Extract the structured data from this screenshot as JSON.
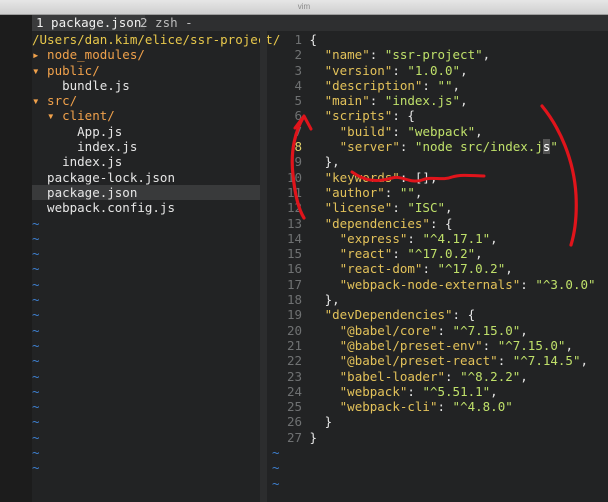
{
  "window": {
    "title": "vim"
  },
  "tabs": [
    {
      "label": "1 package.json"
    },
    {
      "label": "2 zsh -"
    }
  ],
  "file_tree": {
    "root": "/Users/dan.kim/elice/ssr-project/",
    "items": [
      {
        "text": "▸ node_modules/",
        "kind": "dir"
      },
      {
        "text": "▾ public/",
        "kind": "dir"
      },
      {
        "text": "    bundle.js",
        "kind": "file"
      },
      {
        "text": "▾ src/",
        "kind": "dir"
      },
      {
        "text": "  ▾ client/",
        "kind": "dir"
      },
      {
        "text": "      App.js",
        "kind": "file"
      },
      {
        "text": "      index.js",
        "kind": "file"
      },
      {
        "text": "    index.js",
        "kind": "file"
      },
      {
        "text": "  package-lock.json",
        "kind": "file"
      },
      {
        "text": "  package.json",
        "kind": "file",
        "current": true
      },
      {
        "text": "  webpack.config.js",
        "kind": "file"
      }
    ],
    "tilde_rows": 17
  },
  "editor": {
    "current_line": 8,
    "lines": [
      {
        "n": "1",
        "indent": "",
        "parts": [
          {
            "t": "{",
            "c": "p"
          }
        ]
      },
      {
        "n": "2",
        "indent": "  ",
        "parts": [
          {
            "t": "\"name\"",
            "c": "k"
          },
          {
            "t": ": ",
            "c": "p"
          },
          {
            "t": "\"ssr-project\"",
            "c": "s"
          },
          {
            "t": ",",
            "c": "p"
          }
        ]
      },
      {
        "n": "3",
        "indent": "  ",
        "parts": [
          {
            "t": "\"version\"",
            "c": "k"
          },
          {
            "t": ": ",
            "c": "p"
          },
          {
            "t": "\"1.0.0\"",
            "c": "s"
          },
          {
            "t": ",",
            "c": "p"
          }
        ]
      },
      {
        "n": "4",
        "indent": "  ",
        "parts": [
          {
            "t": "\"description\"",
            "c": "k"
          },
          {
            "t": ": ",
            "c": "p"
          },
          {
            "t": "\"\"",
            "c": "s"
          },
          {
            "t": ",",
            "c": "p"
          }
        ]
      },
      {
        "n": "5",
        "indent": "  ",
        "parts": [
          {
            "t": "\"main\"",
            "c": "k"
          },
          {
            "t": ": ",
            "c": "p"
          },
          {
            "t": "\"index.js\"",
            "c": "s"
          },
          {
            "t": ",",
            "c": "p"
          }
        ]
      },
      {
        "n": "6",
        "indent": "  ",
        "parts": [
          {
            "t": "\"scripts\"",
            "c": "k"
          },
          {
            "t": ": {",
            "c": "p"
          }
        ]
      },
      {
        "n": "7",
        "indent": "    ",
        "parts": [
          {
            "t": "\"build\"",
            "c": "k"
          },
          {
            "t": ": ",
            "c": "p"
          },
          {
            "t": "\"webpack\"",
            "c": "s"
          },
          {
            "t": ",",
            "c": "p"
          }
        ]
      },
      {
        "n": "8",
        "indent": "    ",
        "parts": [
          {
            "t": "\"server\"",
            "c": "k"
          },
          {
            "t": ": ",
            "c": "p"
          },
          {
            "t": "\"node src/index.j",
            "c": "s"
          },
          {
            "t": "s",
            "c": "cursor"
          },
          {
            "t": "\"",
            "c": "s"
          }
        ]
      },
      {
        "n": "9",
        "indent": "  ",
        "parts": [
          {
            "t": "},",
            "c": "p"
          }
        ]
      },
      {
        "n": "10",
        "indent": "  ",
        "parts": [
          {
            "t": "\"keywords\"",
            "c": "k"
          },
          {
            "t": ": [],",
            "c": "p"
          }
        ]
      },
      {
        "n": "11",
        "indent": "  ",
        "parts": [
          {
            "t": "\"author\"",
            "c": "k"
          },
          {
            "t": ": ",
            "c": "p"
          },
          {
            "t": "\"\"",
            "c": "s"
          },
          {
            "t": ",",
            "c": "p"
          }
        ]
      },
      {
        "n": "12",
        "indent": "  ",
        "parts": [
          {
            "t": "\"license\"",
            "c": "k"
          },
          {
            "t": ": ",
            "c": "p"
          },
          {
            "t": "\"ISC\"",
            "c": "s"
          },
          {
            "t": ",",
            "c": "p"
          }
        ]
      },
      {
        "n": "13",
        "indent": "  ",
        "parts": [
          {
            "t": "\"dependencies\"",
            "c": "k"
          },
          {
            "t": ": {",
            "c": "p"
          }
        ]
      },
      {
        "n": "14",
        "indent": "    ",
        "parts": [
          {
            "t": "\"express\"",
            "c": "k"
          },
          {
            "t": ": ",
            "c": "p"
          },
          {
            "t": "\"^4.17.1\"",
            "c": "s"
          },
          {
            "t": ",",
            "c": "p"
          }
        ]
      },
      {
        "n": "15",
        "indent": "    ",
        "parts": [
          {
            "t": "\"react\"",
            "c": "k"
          },
          {
            "t": ": ",
            "c": "p"
          },
          {
            "t": "\"^17.0.2\"",
            "c": "s"
          },
          {
            "t": ",",
            "c": "p"
          }
        ]
      },
      {
        "n": "16",
        "indent": "    ",
        "parts": [
          {
            "t": "\"react-dom\"",
            "c": "k"
          },
          {
            "t": ": ",
            "c": "p"
          },
          {
            "t": "\"^17.0.2\"",
            "c": "s"
          },
          {
            "t": ",",
            "c": "p"
          }
        ]
      },
      {
        "n": "17",
        "indent": "    ",
        "parts": [
          {
            "t": "\"webpack-node-externals\"",
            "c": "k"
          },
          {
            "t": ": ",
            "c": "p"
          },
          {
            "t": "\"^3.0.0\"",
            "c": "s"
          }
        ]
      },
      {
        "n": "18",
        "indent": "  ",
        "parts": [
          {
            "t": "},",
            "c": "p"
          }
        ]
      },
      {
        "n": "19",
        "indent": "  ",
        "parts": [
          {
            "t": "\"devDependencies\"",
            "c": "k"
          },
          {
            "t": ": {",
            "c": "p"
          }
        ]
      },
      {
        "n": "20",
        "indent": "    ",
        "parts": [
          {
            "t": "\"@babel/core\"",
            "c": "k"
          },
          {
            "t": ": ",
            "c": "p"
          },
          {
            "t": "\"^7.15.0\"",
            "c": "s"
          },
          {
            "t": ",",
            "c": "p"
          }
        ]
      },
      {
        "n": "21",
        "indent": "    ",
        "parts": [
          {
            "t": "\"@babel/preset-env\"",
            "c": "k"
          },
          {
            "t": ": ",
            "c": "p"
          },
          {
            "t": "\"^7.15.0\"",
            "c": "s"
          },
          {
            "t": ",",
            "c": "p"
          }
        ]
      },
      {
        "n": "22",
        "indent": "    ",
        "parts": [
          {
            "t": "\"@babel/preset-react\"",
            "c": "k"
          },
          {
            "t": ": ",
            "c": "p"
          },
          {
            "t": "\"^7.14.5\"",
            "c": "s"
          },
          {
            "t": ",",
            "c": "p"
          }
        ]
      },
      {
        "n": "23",
        "indent": "    ",
        "parts": [
          {
            "t": "\"babel-loader\"",
            "c": "k"
          },
          {
            "t": ": ",
            "c": "p"
          },
          {
            "t": "\"^8.2.2\"",
            "c": "s"
          },
          {
            "t": ",",
            "c": "p"
          }
        ]
      },
      {
        "n": "24",
        "indent": "    ",
        "parts": [
          {
            "t": "\"webpack\"",
            "c": "k"
          },
          {
            "t": ": ",
            "c": "p"
          },
          {
            "t": "\"^5.51.1\"",
            "c": "s"
          },
          {
            "t": ",",
            "c": "p"
          }
        ]
      },
      {
        "n": "25",
        "indent": "    ",
        "parts": [
          {
            "t": "\"webpack-cli\"",
            "c": "k"
          },
          {
            "t": ": ",
            "c": "p"
          },
          {
            "t": "\"^4.8.0\"",
            "c": "s"
          }
        ]
      },
      {
        "n": "26",
        "indent": "  ",
        "parts": [
          {
            "t": "}",
            "c": "p"
          }
        ]
      },
      {
        "n": "27",
        "indent": "",
        "parts": [
          {
            "t": "}",
            "c": "p"
          }
        ]
      }
    ],
    "tilde_rows": 3
  },
  "colors": {
    "annotation": "#e0141b",
    "key": "#e3c25a",
    "string": "#bfe06a",
    "directory": "#f0a14b",
    "tilde": "#3e7fcf"
  }
}
